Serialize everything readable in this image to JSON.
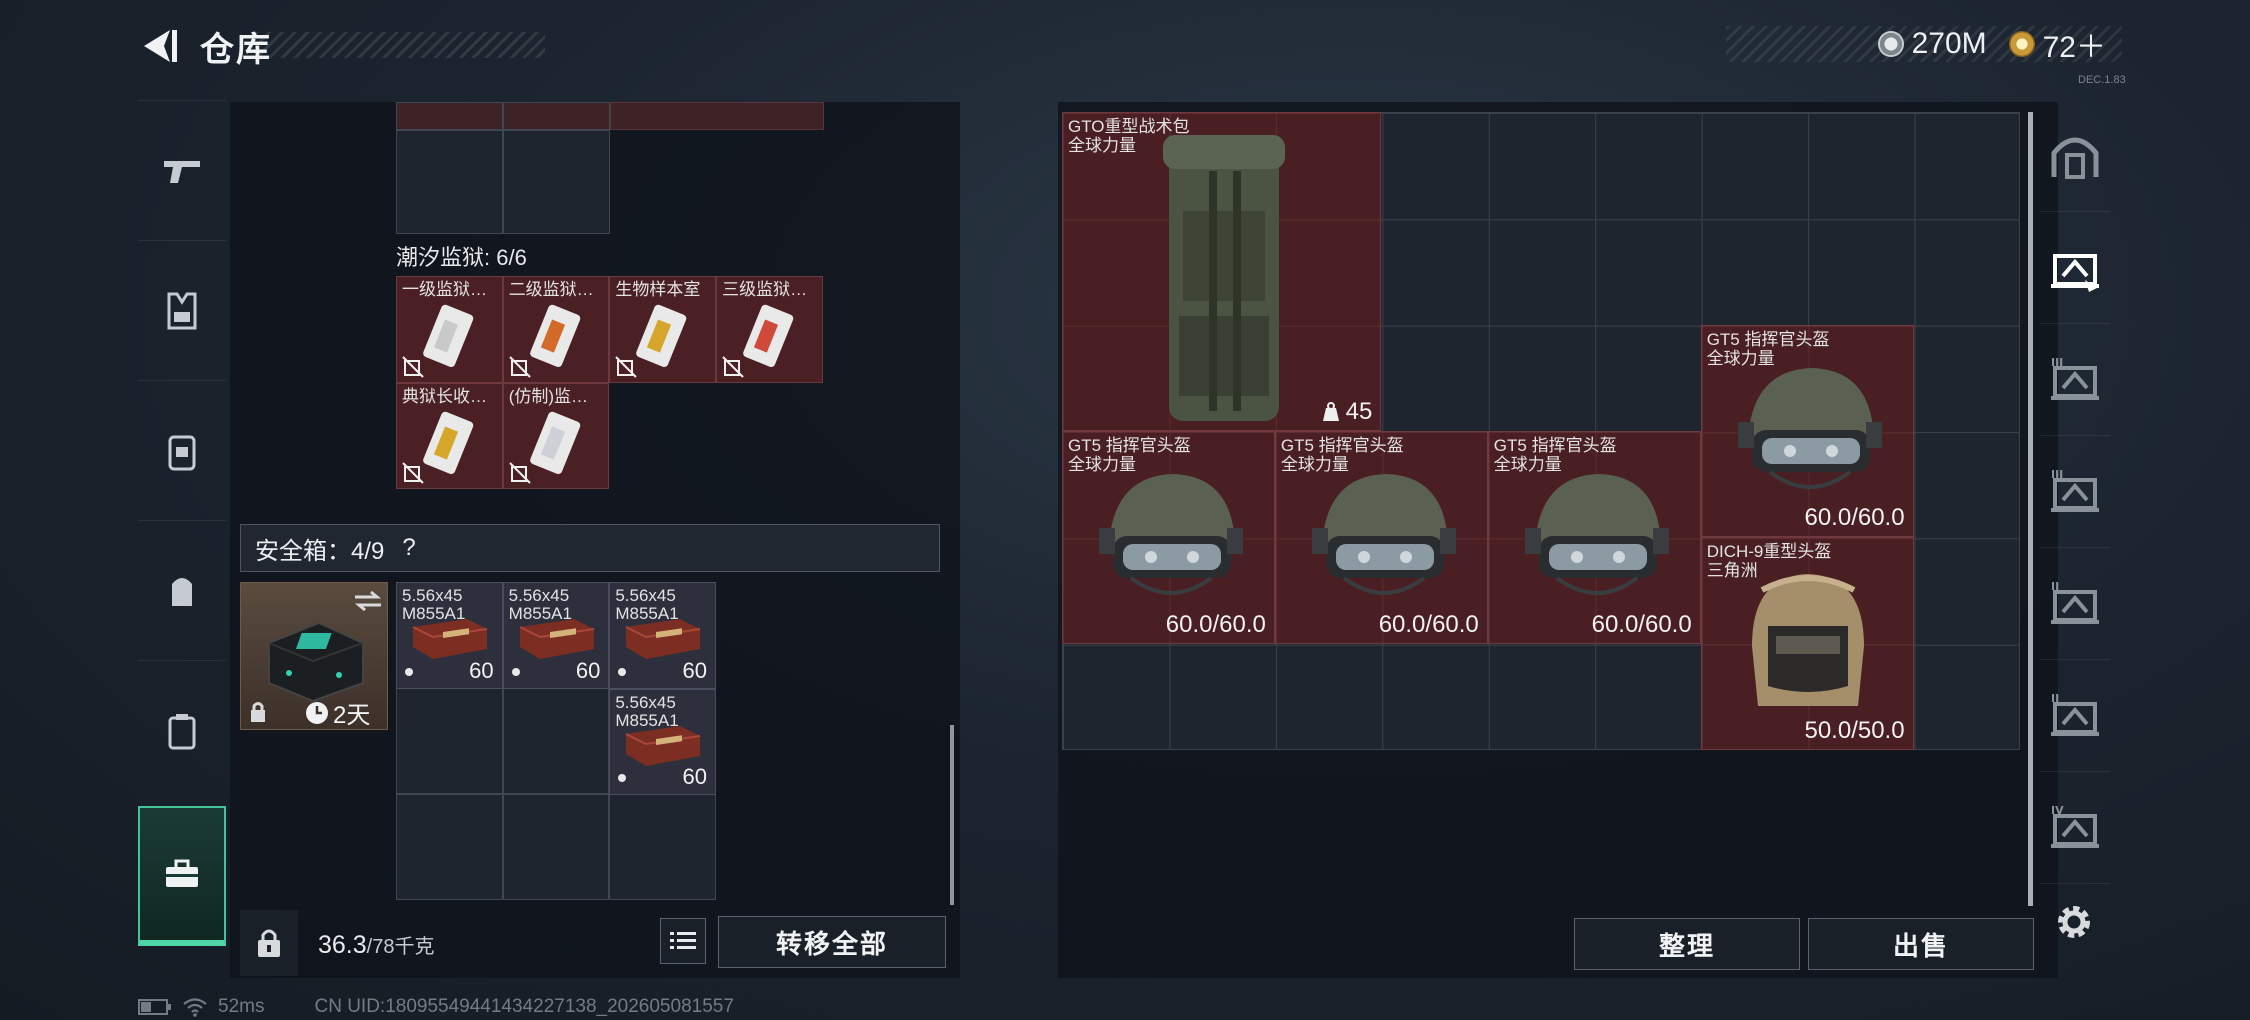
{
  "header": {
    "title": "仓库",
    "currency_coins": "270M",
    "currency_tokens": "72＋",
    "version": "DEC.1.83"
  },
  "colors": {
    "item_bg": "#4a1f23",
    "cell_bg": "#1e252e",
    "active_accent": "#4fd6a8"
  },
  "left_nav": {
    "items": [
      {
        "icon": "pistol-icon"
      },
      {
        "icon": "vest-icon"
      },
      {
        "icon": "backpack-icon"
      },
      {
        "icon": "pouch-icon"
      },
      {
        "icon": "case-icon"
      },
      {
        "icon": "toolbox-icon",
        "active": true
      }
    ]
  },
  "left_panel": {
    "prison_section": "潮汐监狱: 6/6",
    "prison_keys": [
      {
        "label": "一级监狱…",
        "color": "#c9c9c9"
      },
      {
        "label": "二级监狱…",
        "color": "#d26a2a"
      },
      {
        "label": "生物样本室",
        "color": "#d6a62b"
      },
      {
        "label": "三级监狱…",
        "color": "#cf4a3b"
      },
      {
        "label": "典狱长收…",
        "color": "#d6a62b"
      },
      {
        "label": "(仿制)监…",
        "color": "#cfcfd8"
      }
    ],
    "safebox": {
      "label": "安全箱：4/9",
      "help": "?",
      "timer": "2天"
    },
    "ammo": [
      {
        "name": "5.56x45\nM855A1",
        "count": "60"
      },
      {
        "name": "5.56x45\nM855A1",
        "count": "60"
      },
      {
        "name": "5.56x45\nM855A1",
        "count": "60"
      },
      {
        "name": "5.56x45\nM855A1",
        "count": "60"
      }
    ],
    "weight_value": "36.3",
    "weight_limit": "/78千克",
    "transfer_all": "转移全部"
  },
  "right_panel": {
    "items": [
      {
        "name": "GTO重型战术包",
        "sub": "全球力量",
        "count": "45"
      },
      {
        "name": "GT5 指挥官头盔",
        "sub": "全球力量",
        "durability": "60.0/60.0"
      },
      {
        "name": "GT5 指挥官头盔",
        "sub": "全球力量",
        "durability": "60.0/60.0"
      },
      {
        "name": "GT5 指挥官头盔",
        "sub": "全球力量",
        "durability": "60.0/60.0"
      },
      {
        "name": "GT5 指挥官头盔",
        "sub": "全球力量",
        "durability": "60.0/60.0"
      },
      {
        "name": "DICH-9重型头盔",
        "sub": "三角洲",
        "durability": "50.0/50.0"
      }
    ],
    "sort_button": "整理",
    "sell_button": "出售"
  },
  "right_nav": {
    "items": [
      {
        "icon": "vault-icon"
      },
      {
        "icon": "storage-page-icon",
        "active": true
      },
      {
        "icon": "storage-page-3-icon",
        "label": "III"
      },
      {
        "icon": "storage-page-3b-icon",
        "label": "III"
      },
      {
        "icon": "storage-page-2-icon",
        "label": "II"
      },
      {
        "icon": "storage-page-5-icon",
        "label": "II"
      },
      {
        "icon": "storage-page-4-icon",
        "label": "IV"
      }
    ]
  },
  "footer": {
    "ping": "52ms",
    "uid": "CN UID:18095549441434227138_202605081557"
  }
}
